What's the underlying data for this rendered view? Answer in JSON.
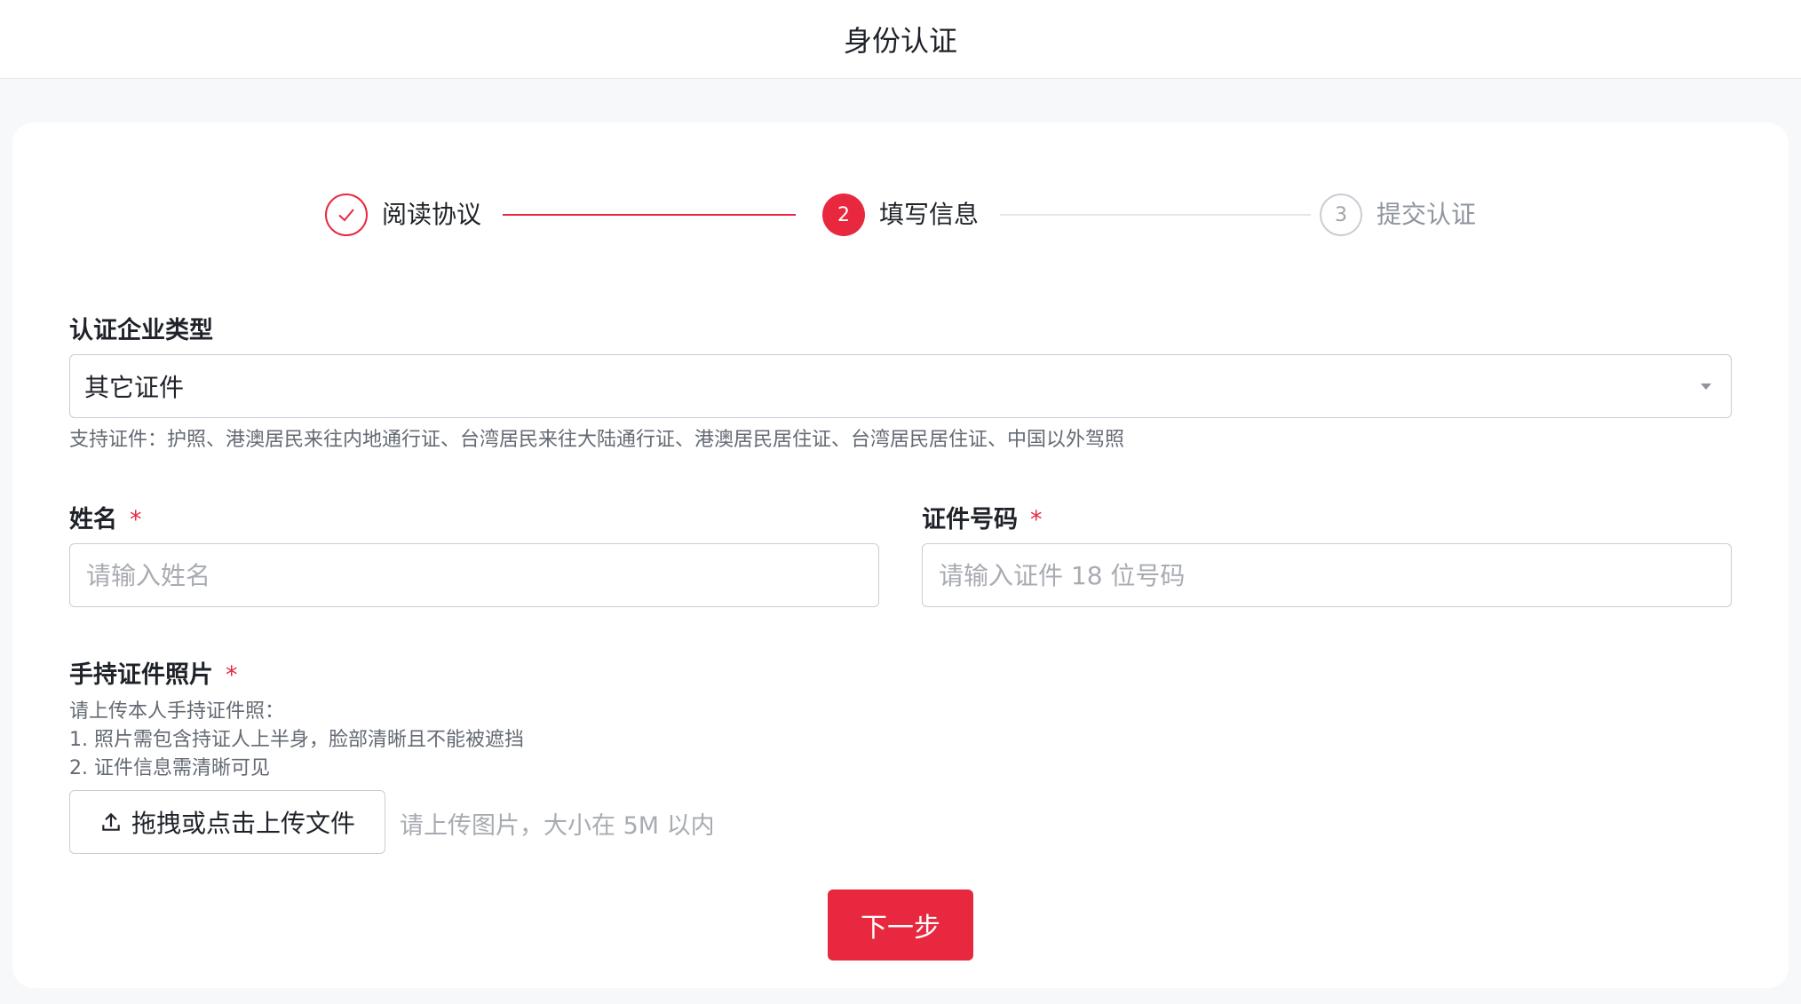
{
  "header": {
    "title": "身份认证"
  },
  "steps": [
    {
      "index": "1",
      "label": "阅读协议",
      "status": "done"
    },
    {
      "index": "2",
      "label": "填写信息",
      "status": "active"
    },
    {
      "index": "3",
      "label": "提交认证",
      "status": "todo"
    }
  ],
  "form": {
    "enterprise_type": {
      "label": "认证企业类型",
      "value": "其它证件",
      "hint": "支持证件：护照、港澳居民来往内地通行证、台湾居民来往大陆通行证、港澳居民居住证、台湾居民居住证、中国以外驾照"
    },
    "name": {
      "label": "姓名",
      "required_mark": "*",
      "placeholder": "请输入姓名"
    },
    "id_number": {
      "label": "证件号码",
      "required_mark": "*",
      "placeholder": "请输入证件 18 位号码"
    },
    "photo": {
      "label": "手持证件照片",
      "required_mark": "*",
      "instructions": [
        "请上传本人手持证件照：",
        "1. 照片需包含持证人上半身，脸部清晰且不能被遮挡",
        "2. 证件信息需清晰可见"
      ],
      "upload_label": "拖拽或点击上传文件",
      "upload_tip": "请上传图片，大小在 5M 以内"
    }
  },
  "actions": {
    "next_label": "下一步"
  },
  "colors": {
    "accent": "#e8283f",
    "border": "#c9cdd4",
    "placeholder": "#a8abb2"
  },
  "icons": {
    "step_done": "check-icon",
    "select": "caret-down-icon",
    "upload": "upload-icon"
  }
}
